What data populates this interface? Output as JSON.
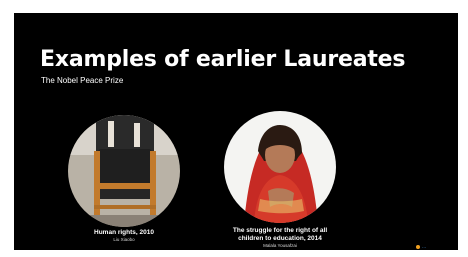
{
  "slide": {
    "title": "Examples of earlier Laureates",
    "subtitle": "The Nobel Peace Prize"
  },
  "laureates": [
    {
      "caption": "Human rights, 2010",
      "name": "Liu Xiaobo"
    },
    {
      "caption_line1": "The struggle for the right of all",
      "caption_line2": "children to education, 2014",
      "name": "Malala Yousafzai"
    }
  ],
  "logo": {
    "text": "..."
  }
}
